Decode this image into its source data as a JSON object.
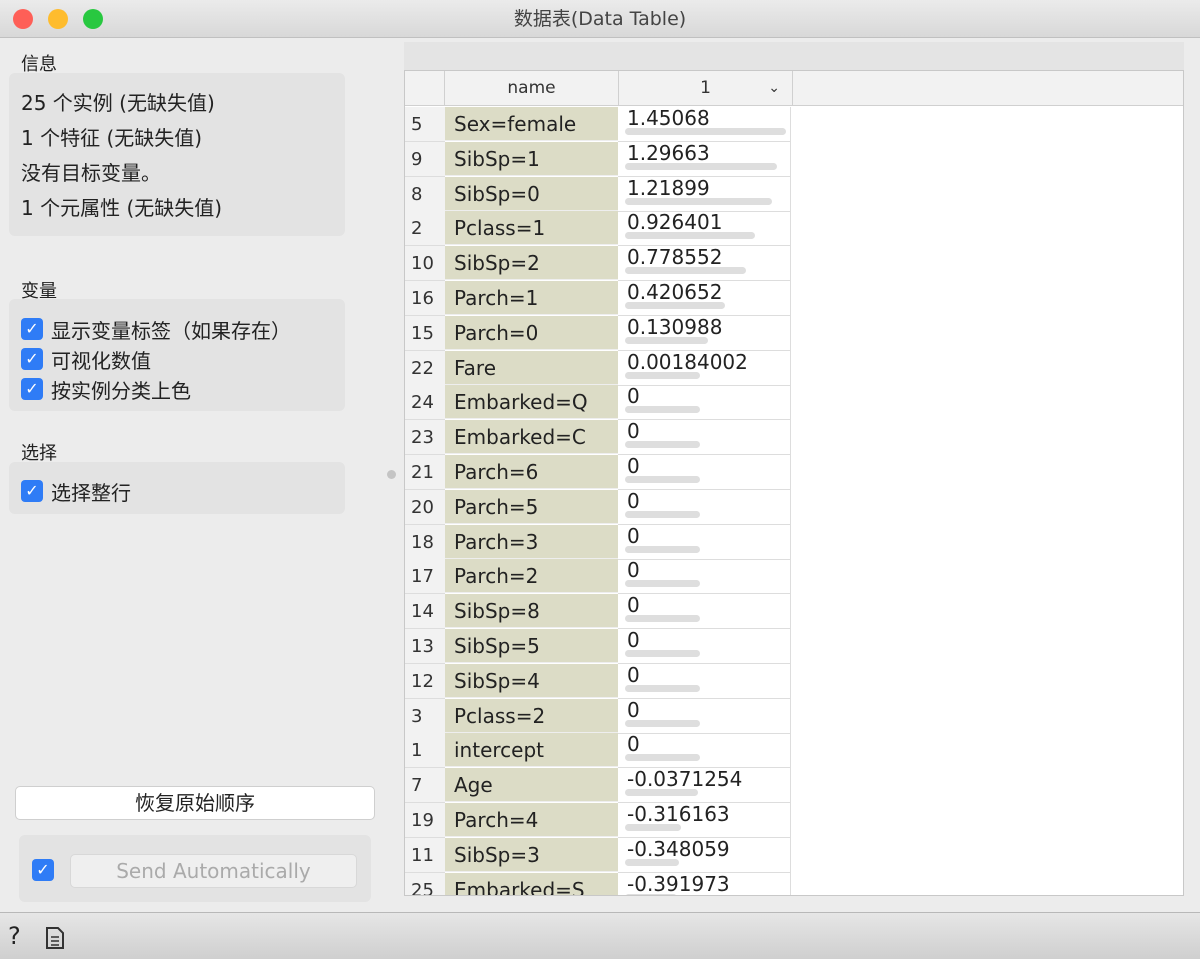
{
  "window": {
    "title": "数据表(Data Table)"
  },
  "info": {
    "title": "信息",
    "lines": [
      "25 个实例 (无缺失值)",
      "1 个特征 (无缺失值)",
      "没有目标变量。",
      "1 个元属性 (无缺失值)"
    ]
  },
  "variables": {
    "title": "变量",
    "options": [
      {
        "label": "显示变量标签（如果存在）",
        "checked": true
      },
      {
        "label": "可视化数值",
        "checked": true
      },
      {
        "label": "按实例分类上色",
        "checked": true
      }
    ]
  },
  "selection": {
    "title": "选择",
    "options": [
      {
        "label": "选择整行",
        "checked": true
      }
    ]
  },
  "restore_button": "恢复原始顺序",
  "send": {
    "label": "Send Automatically",
    "checked": true
  },
  "table": {
    "headers": [
      "name",
      "1"
    ],
    "rows": [
      [
        "5",
        "Sex=female",
        "1.45068"
      ],
      [
        "9",
        "SibSp=1",
        "1.29663"
      ],
      [
        "8",
        "SibSp=0",
        "1.21899"
      ],
      [
        "2",
        "Pclass=1",
        "0.926401"
      ],
      [
        "10",
        "SibSp=2",
        "0.778552"
      ],
      [
        "16",
        "Parch=1",
        "0.420652"
      ],
      [
        "15",
        "Parch=0",
        "0.130988"
      ],
      [
        "22",
        "Fare",
        "0.00184002"
      ],
      [
        "24",
        "Embarked=Q",
        "0"
      ],
      [
        "23",
        "Embarked=C",
        "0"
      ],
      [
        "21",
        "Parch=6",
        "0"
      ],
      [
        "20",
        "Parch=5",
        "0"
      ],
      [
        "18",
        "Parch=3",
        "0"
      ],
      [
        "17",
        "Parch=2",
        "0"
      ],
      [
        "14",
        "SibSp=8",
        "0"
      ],
      [
        "13",
        "SibSp=5",
        "0"
      ],
      [
        "12",
        "SibSp=4",
        "0"
      ],
      [
        "3",
        "Pclass=2",
        "0"
      ],
      [
        "1",
        "intercept",
        "0"
      ],
      [
        "7",
        "Age",
        "-0.0371254"
      ],
      [
        "19",
        "Parch=4",
        "-0.316163"
      ],
      [
        "11",
        "SibSp=3",
        "-0.348059"
      ],
      [
        "25",
        "Embarked=S",
        "-0.391973"
      ]
    ]
  },
  "colors": {
    "accent": "#2f7cf6",
    "name_column": "#dcdcc6"
  }
}
